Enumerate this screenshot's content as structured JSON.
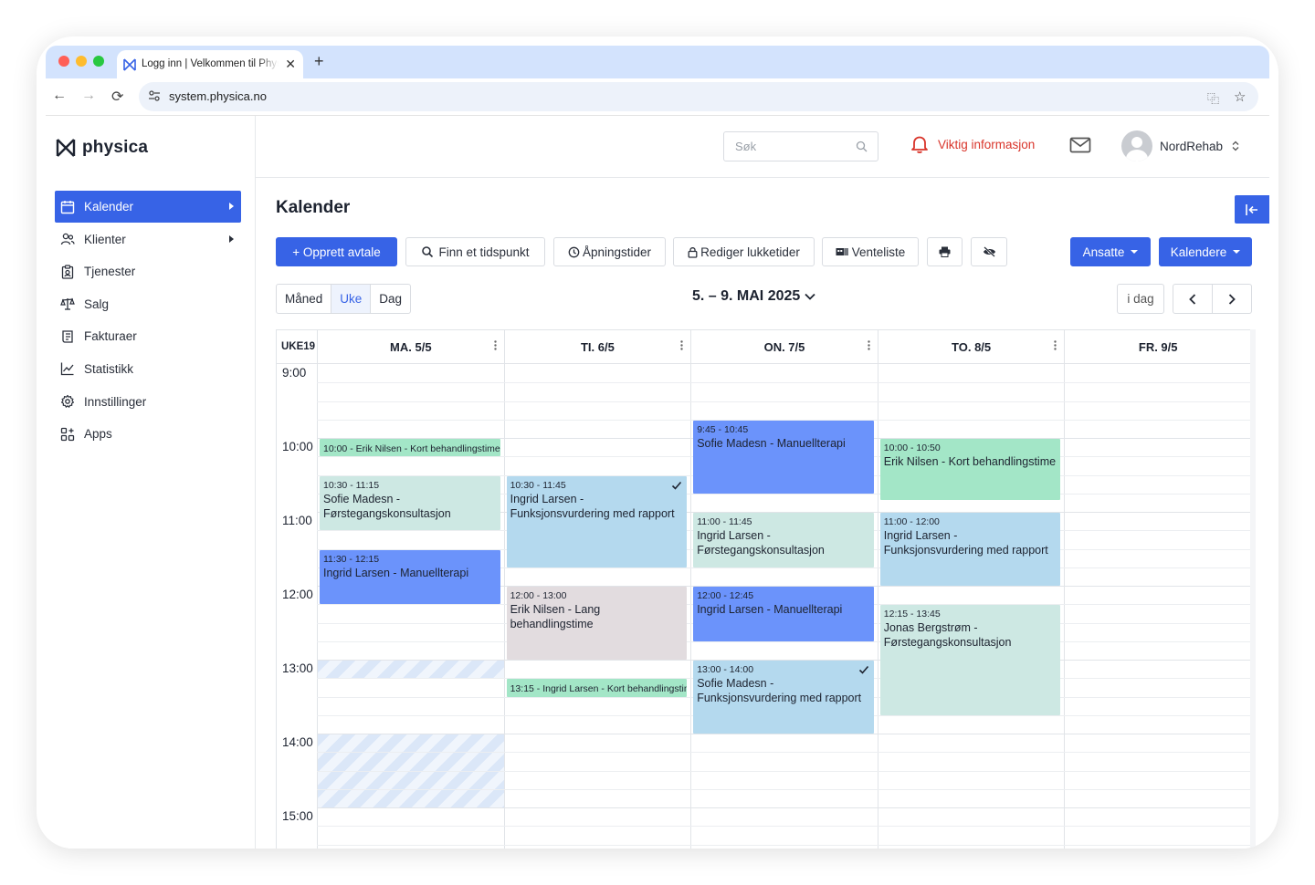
{
  "browser": {
    "tab_title": "Logg inn | Velkommen til Physica",
    "url": "system.physica.no",
    "dots": [
      "#ff5f57",
      "#febc2e",
      "#28c840"
    ]
  },
  "app": {
    "logo": "physica",
    "brand_color": "#3763e6",
    "sidebar": {
      "items": [
        {
          "label": "Kalender",
          "icon": "calendar-icon",
          "active": true,
          "caret": true
        },
        {
          "label": "Klienter",
          "icon": "users-icon",
          "caret": true
        },
        {
          "label": "Tjenester",
          "icon": "clipboard-icon"
        },
        {
          "label": "Salg",
          "icon": "scale-icon"
        },
        {
          "label": "Fakturaer",
          "icon": "invoice-icon"
        },
        {
          "label": "Statistikk",
          "icon": "chart-icon"
        },
        {
          "label": "Innstillinger",
          "icon": "gear-icon"
        },
        {
          "label": "Apps",
          "icon": "apps-icon"
        }
      ]
    },
    "topbar": {
      "search_placeholder": "Søk",
      "info_label": "Viktig informasjon",
      "user_name": "NordRehab"
    },
    "page_title": "Kalender",
    "toolbar": {
      "create": "+ Opprett avtale",
      "find_time": "Finn et tidspunkt",
      "opening_hours": "Åpningstider",
      "closed_times": "Rediger lukketider",
      "waitlist": "Venteliste",
      "staff": "Ansatte",
      "calendars": "Kalendere"
    },
    "views": [
      "Måned",
      "Uke",
      "Dag"
    ],
    "active_view": "Uke",
    "date_range": "5. – 9. MAI 2025",
    "today": "i dag",
    "calendar": {
      "week_label": "UKE19",
      "days": [
        "MA. 5/5",
        "TI. 6/5",
        "ON. 7/5",
        "TO. 8/5",
        "FR. 9/5"
      ],
      "hours": [
        "9:00",
        "10:00",
        "11:00",
        "12:00",
        "13:00",
        "14:00",
        "15:00"
      ],
      "events": [
        {
          "day": 0,
          "start": "10:00",
          "end": "10:15",
          "time": "10:00 -",
          "title": "Erik Nilsen - Kort behandlingstime",
          "color": "green",
          "compact": true
        },
        {
          "day": 0,
          "start": "10:30",
          "end": "11:15",
          "time": "10:30 - 11:15",
          "title": "Sofie Madesn - Førstegangskonsultasjon",
          "color": "mint"
        },
        {
          "day": 0,
          "start": "11:30",
          "end": "12:15",
          "time": "11:30 - 12:15",
          "title": "Ingrid Larsen - Manuellterapi",
          "color": "blue"
        },
        {
          "day": 1,
          "start": "10:30",
          "end": "11:45",
          "time": "10:30 - 11:45",
          "title": "Ingrid Larsen - Funksjonsvurdering med rapport",
          "color": "lblue",
          "check": true
        },
        {
          "day": 1,
          "start": "12:00",
          "end": "13:00",
          "time": "12:00 - 13:00",
          "title": "Erik Nilsen - Lang behandlingstime",
          "color": "grey"
        },
        {
          "day": 1,
          "start": "13:15",
          "end": "13:30",
          "time": "13:15 -",
          "title": "Ingrid Larsen - Kort behandlingstime",
          "color": "green",
          "compact": true
        },
        {
          "day": 2,
          "start": "9:45",
          "end": "10:45",
          "time": "9:45 - 10:45",
          "title": "Sofie Madesn - Manuellterapi",
          "color": "blue"
        },
        {
          "day": 2,
          "start": "11:00",
          "end": "11:45",
          "time": "11:00 - 11:45",
          "title": "Ingrid Larsen - Førstegangskonsultasjon",
          "color": "mint"
        },
        {
          "day": 2,
          "start": "12:00",
          "end": "12:45",
          "time": "12:00 - 12:45",
          "title": "Ingrid Larsen - Manuellterapi",
          "color": "blue"
        },
        {
          "day": 2,
          "start": "13:00",
          "end": "14:00",
          "time": "13:00 - 14:00",
          "title": "Sofie Madesn - Funksjonsvurdering med rapport",
          "color": "lblue",
          "check": true
        },
        {
          "day": 3,
          "start": "10:00",
          "end": "10:50",
          "time": "10:00 - 10:50",
          "title": "Erik Nilsen - Kort behandlingstime",
          "color": "green"
        },
        {
          "day": 3,
          "start": "11:00",
          "end": "12:00",
          "time": "11:00 - 12:00",
          "title": "Ingrid Larsen - Funksjonsvurdering med rapport",
          "color": "lblue"
        },
        {
          "day": 3,
          "start": "12:15",
          "end": "13:45",
          "time": "12:15 - 13:45",
          "title": "Jonas Bergstrøm - Førstegangskonsultasjon",
          "color": "mint"
        }
      ],
      "unavailable": [
        {
          "day": 0,
          "start": "13:00",
          "end": "13:15"
        },
        {
          "day": 0,
          "start": "14:00",
          "end": "15:00"
        }
      ]
    }
  }
}
